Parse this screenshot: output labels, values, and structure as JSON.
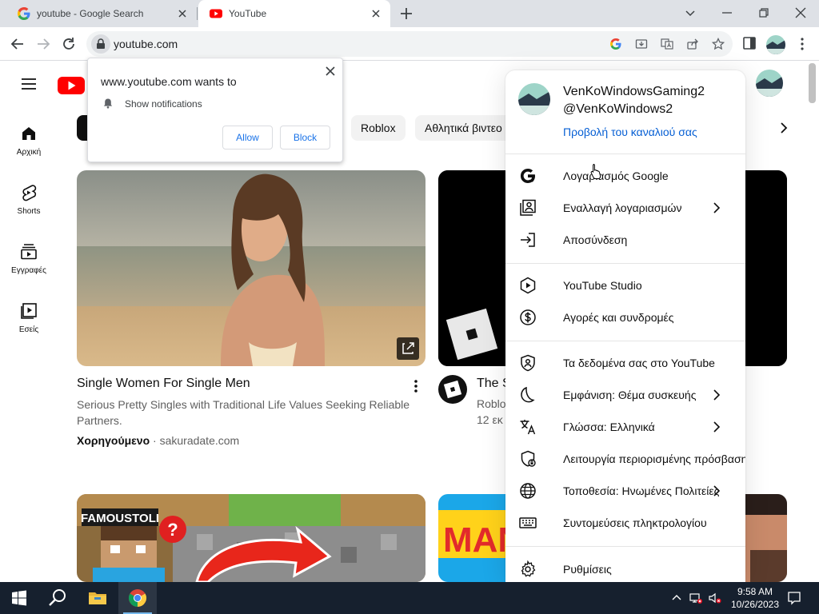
{
  "browser": {
    "tabs": [
      {
        "title": "youtube - Google Search",
        "favicon": "google-g-icon",
        "active": false
      },
      {
        "title": "YouTube",
        "favicon": "youtube-icon",
        "active": true
      }
    ],
    "address": "youtube.com"
  },
  "youtube": {
    "sidebar": [
      {
        "label": "Αρχική",
        "icon": "home-icon"
      },
      {
        "label": "Shorts",
        "icon": "shorts-icon"
      },
      {
        "label": "Εγγραφές",
        "icon": "subscriptions-icon"
      },
      {
        "label": "Εσείς",
        "icon": "library-icon"
      }
    ],
    "chips": [
      "Roblox",
      "Αθλητικά βιντεο"
    ],
    "video1": {
      "title": "Single Women For Single Men",
      "description": "Serious Pretty Singles with Traditional Life Values Seeking Reliable Partners.",
      "sponsored": "Χορηγούμενο",
      "sep": "·",
      "domain": "sakuradate.com"
    },
    "video2": {
      "title": "The S",
      "channel": "Roblo",
      "stats": "12 εκ"
    }
  },
  "notification": {
    "title": "www.youtube.com wants to",
    "permission": "Show notifications",
    "allow": "Allow",
    "block": "Block"
  },
  "account_menu": {
    "name": "VenKoWindowsGaming2",
    "handle": "@VenKoWindows2",
    "channel_link": "Προβολή του καναλιού σας",
    "items": [
      {
        "label": "Λογαριασμός Google",
        "icon": "google-g-icon",
        "chevron": false
      },
      {
        "label": "Εναλλαγή λογαριασμών",
        "icon": "switch-account-icon",
        "chevron": true
      },
      {
        "label": "Αποσύνδεση",
        "icon": "sign-out-icon",
        "chevron": false
      },
      {
        "label": "YouTube Studio",
        "icon": "studio-icon",
        "chevron": false
      },
      {
        "label": "Αγορές και συνδρομές",
        "icon": "dollar-icon",
        "chevron": false
      },
      {
        "label": "Τα δεδομένα σας στο YouTube",
        "icon": "shield-person-icon",
        "chevron": false
      },
      {
        "label": "Εμφάνιση: Θέμα συσκευής",
        "icon": "moon-icon",
        "chevron": true
      },
      {
        "label": "Γλώσσα: Ελληνικά",
        "icon": "translate-icon",
        "chevron": true
      },
      {
        "label": "Λειτουργία περιορισμένης πρόσβασης",
        "icon": "restricted-icon",
        "chevron": false
      },
      {
        "label": "Τοποθεσία: Ηνωμένες Πολιτείες",
        "icon": "globe-icon",
        "chevron": true
      },
      {
        "label": "Συντομεύσεις πληκτρολογίου",
        "icon": "keyboard-icon",
        "chevron": false
      },
      {
        "label": "Ρυθμίσεις",
        "icon": "gear-icon",
        "chevron": false
      }
    ]
  },
  "taskbar": {
    "time": "9:58 AM",
    "date": "10/26/2023"
  },
  "colors": {
    "youtube_red": "#ff0000",
    "link_blue": "#065fd4",
    "chrome_blue": "#1a73e8",
    "taskbar": "#16202e"
  }
}
